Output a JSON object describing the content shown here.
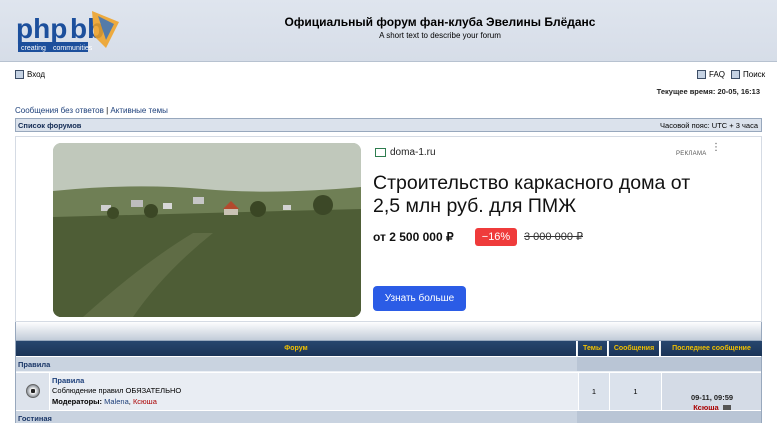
{
  "header": {
    "title": "Официальный форум фан-клуба Эвелины Блёданс",
    "description": "A short text to describe your forum",
    "logo_text": "phpbb",
    "logo_tagline": "creating communities"
  },
  "nav": {
    "login": "Вход",
    "faq": "FAQ",
    "search": "Поиск",
    "current_time": "Текущее время: 20-05, 16:13"
  },
  "quicklinks": {
    "unanswered": "Сообщения без ответов",
    "separator": "|",
    "active": "Активные темы"
  },
  "breadcrumb": {
    "index": "Список форумов",
    "timezone": "Часовой пояс: UTC + 3 часа"
  },
  "ad": {
    "domain": "doma-1.ru",
    "label": "РЕКЛАМА",
    "menu": "⋮",
    "headline": "Строительство каркасного дома от 2,5 млн руб. для ПМЖ",
    "price": "от 2 500 000 ₽",
    "discount": "−16%",
    "old_price": "3 000 000 ₽",
    "button": "Узнать больше"
  },
  "forum_table": {
    "headers": {
      "forum": "Форум",
      "topics": "Темы",
      "posts": "Сообщения",
      "last_post": "Последнее сообщение"
    },
    "categories": [
      {
        "label": "Правила"
      },
      {
        "label": "Гостиная"
      }
    ],
    "forums": [
      {
        "name": "Правила",
        "description": "Соблюдение правил ОБЯЗАТЕЛЬНО",
        "moderators_label": "Модераторы:",
        "moderators": [
          "Malena",
          "Ксюша"
        ],
        "topics": "1",
        "posts": "1",
        "last_post_date": "09-11, 09:59",
        "last_post_user": "Ксюша"
      }
    ]
  }
}
